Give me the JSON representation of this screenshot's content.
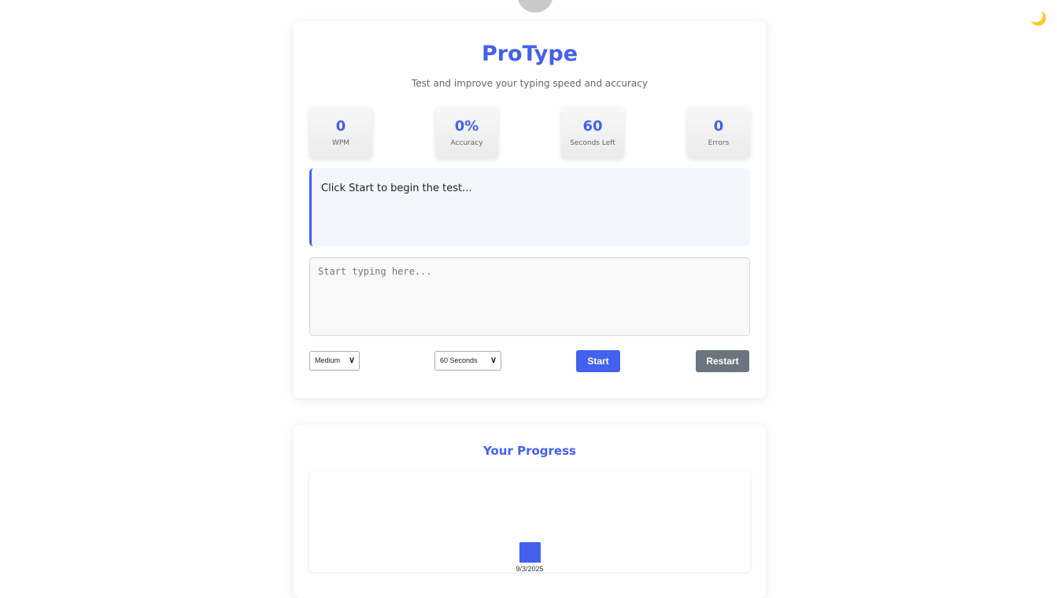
{
  "app": {
    "title": "ProType",
    "subtitle": "Test and improve your typing speed and accuracy",
    "theme_toggle_icon": "🌙"
  },
  "stats": [
    {
      "value": "0",
      "label": "WPM"
    },
    {
      "value": "0%",
      "label": "Accuracy"
    },
    {
      "value": "60",
      "label": "Seconds Left"
    },
    {
      "value": "0",
      "label": "Errors"
    }
  ],
  "prompt": {
    "text": "Click Start to begin the test..."
  },
  "input": {
    "value": "",
    "placeholder": "Start typing here..."
  },
  "controls": {
    "difficulty": {
      "selected": "Medium"
    },
    "duration": {
      "selected": "60 Seconds"
    },
    "start_label": "Start",
    "restart_label": "Restart"
  },
  "progress": {
    "title": "Your Progress"
  },
  "colors": {
    "accent": "#4361ee",
    "secondary_button": "#6c757d"
  },
  "chart_data": {
    "type": "bar",
    "categories": [
      "9/3/2025"
    ],
    "values": [
      0
    ]
  }
}
